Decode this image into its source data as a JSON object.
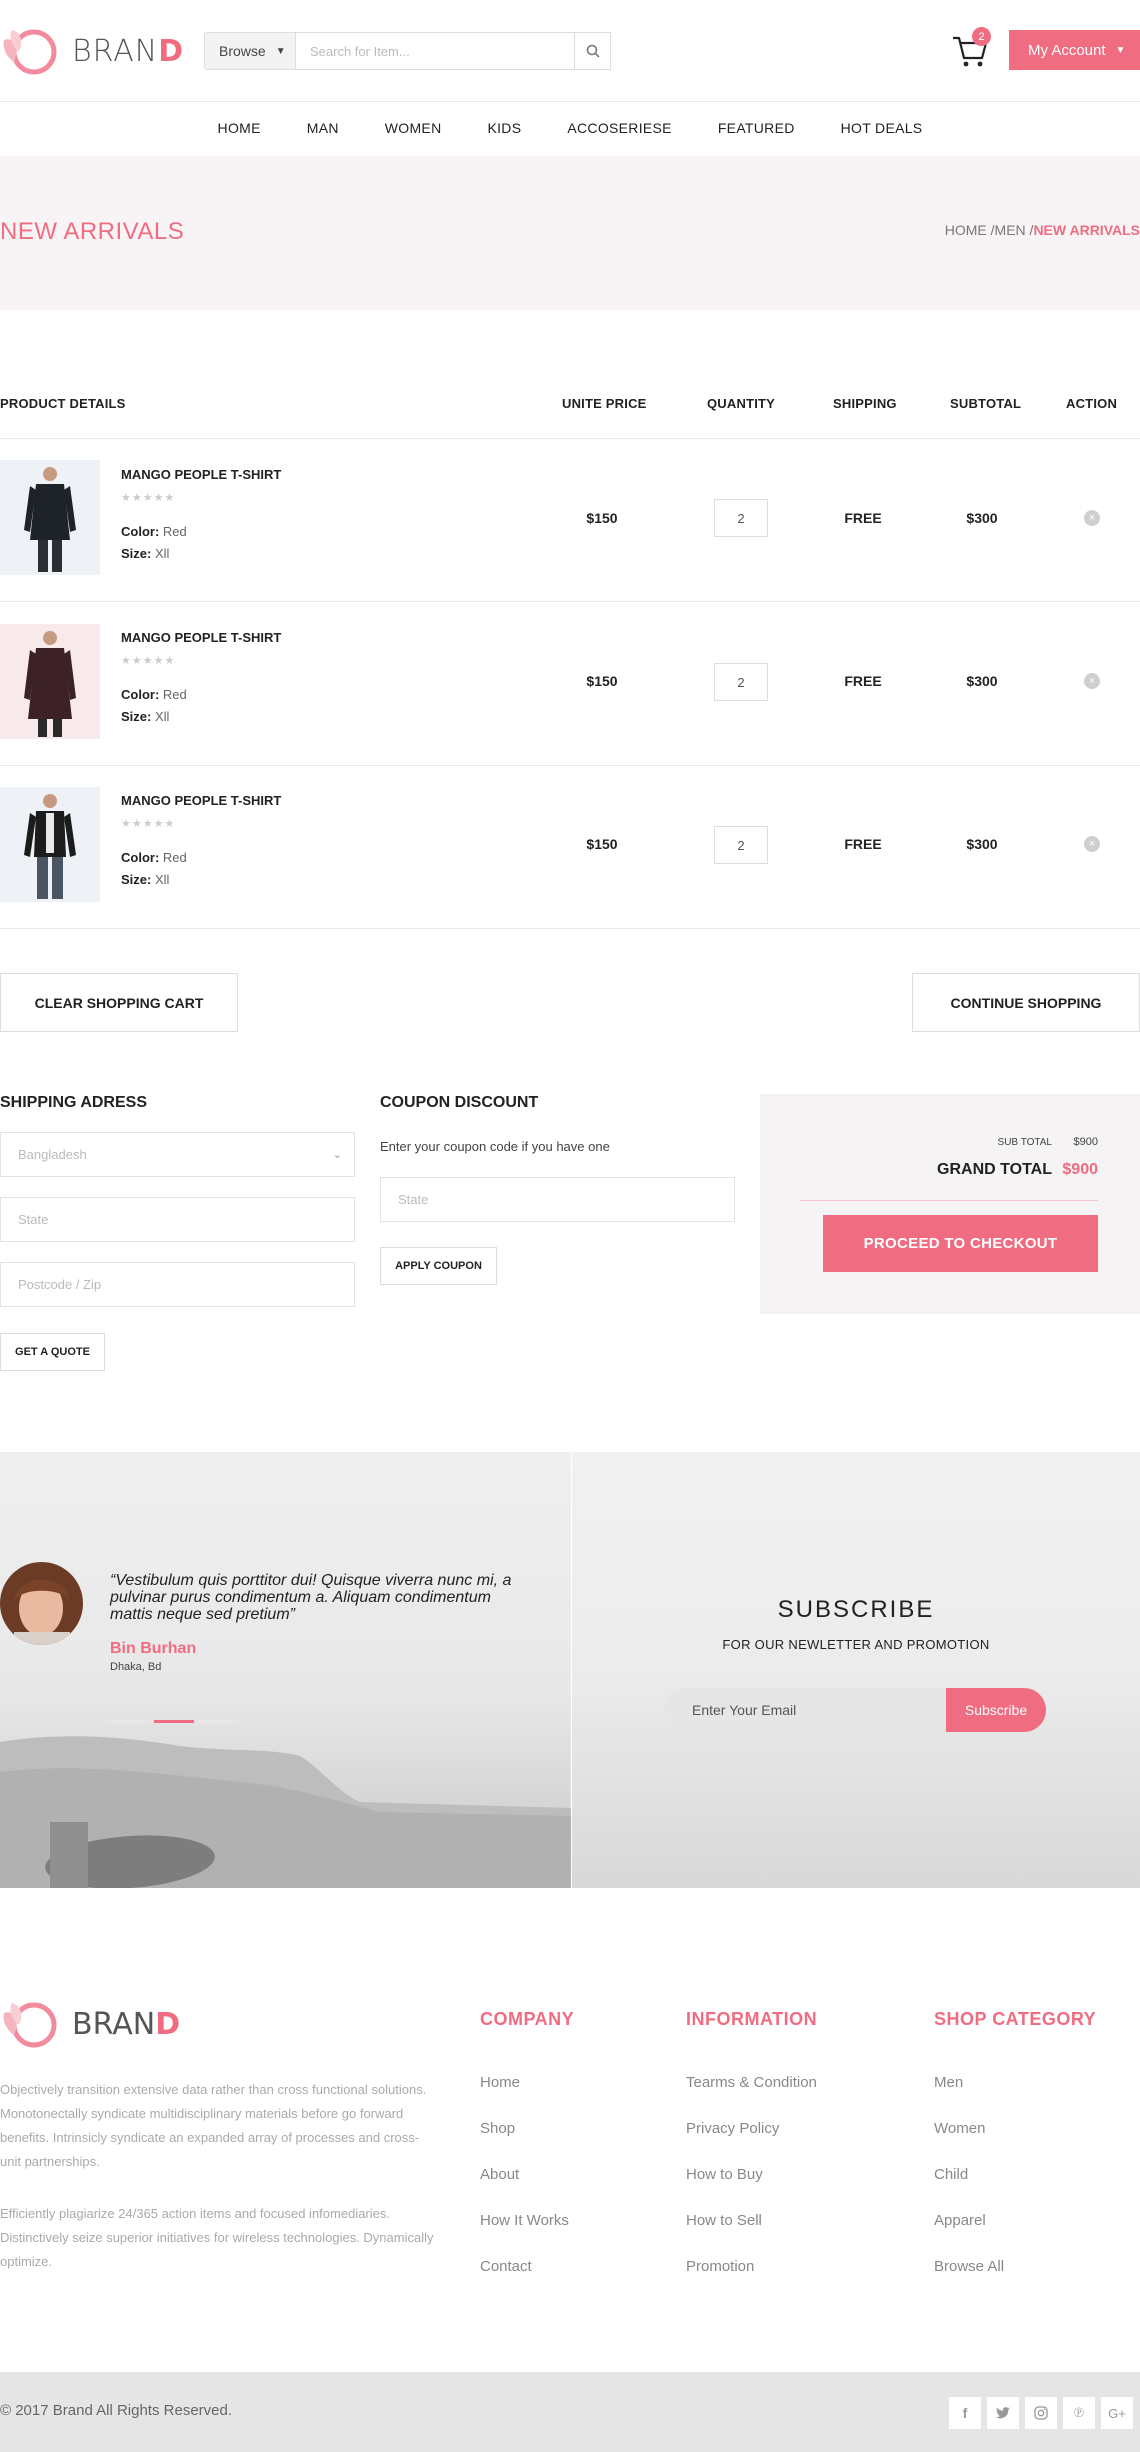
{
  "brand": {
    "name_main": "BRAN",
    "name_accent": "D"
  },
  "header": {
    "browse_label": "Browse",
    "search_placeholder": "Search for Item...",
    "cart_count": "2",
    "account_label": "My Account"
  },
  "nav": [
    "HOME",
    "MAN",
    "WOMEN",
    "KIDS",
    "ACCOSERIESE",
    "FEATURED",
    "HOT DEALS"
  ],
  "banner": {
    "title": "NEW ARRIVALS",
    "crumb_home": "HOME",
    "crumb_men": "MEN",
    "crumb_active": "NEW ARRIVALS"
  },
  "table": {
    "headers": [
      "PRODUCT DETAILS",
      "UNITE PRICE",
      "QUANTITY",
      "SHIPPING",
      "SUBTOTAL",
      "ACTION"
    ],
    "rows": [
      {
        "name": "MANGO PEOPLE T-SHIRT",
        "stars": "★★★★★",
        "color_label": "Color:",
        "color": "Red",
        "size_label": "Size:",
        "size": "Xll",
        "price": "$150",
        "qty": "2",
        "shipping": "FREE",
        "subtotal": "$300"
      },
      {
        "name": "MANGO PEOPLE T-SHIRT",
        "stars": "★★★★★",
        "color_label": "Color:",
        "color": "Red",
        "size_label": "Size:",
        "size": "Xll",
        "price": "$150",
        "qty": "2",
        "shipping": "FREE",
        "subtotal": "$300"
      },
      {
        "name": "MANGO PEOPLE T-SHIRT",
        "stars": "★★★★★",
        "color_label": "Color:",
        "color": "Red",
        "size_label": "Size:",
        "size": "Xll",
        "price": "$150",
        "qty": "2",
        "shipping": "FREE",
        "subtotal": "$300"
      }
    ],
    "clear_label": "CLEAR SHOPPING CART",
    "continue_label": "CONTINUE SHOPPING"
  },
  "shipping": {
    "title": "SHIPPING ADRESS",
    "country": "Bangladesh",
    "state_placeholder": "State",
    "zip_placeholder": "Postcode / Zip",
    "quote_label": "GET A QUOTE"
  },
  "coupon": {
    "title": "COUPON DISCOUNT",
    "hint": "Enter your coupon code if you have one",
    "placeholder": "State",
    "apply_label": "APPLY COUPON"
  },
  "summary": {
    "sub_label": "SUB TOTAL",
    "sub_value": "$900",
    "grand_label": "GRAND TOTAL",
    "grand_value": "$900",
    "checkout_label": "PROCEED TO CHECKOUT"
  },
  "testimonial": {
    "quote": "“Vestibulum quis porttitor dui! Quisque viverra nunc mi, a pulvinar purus condimentum a. Aliquam condimentum mattis neque sed pretium”",
    "name": "Bin Burhan",
    "location": "Dhaka, Bd"
  },
  "subscribe": {
    "title": "SUBSCRIBE",
    "subtitle": "FOR OUR NEWLETTER AND PROMOTION",
    "email_placeholder": "Enter Your Email",
    "button_label": "Subscribe"
  },
  "footer": {
    "para1": "Objectively transition extensive data rather than cross functional solutions. Monotonectally syndicate multidisciplinary materials before go forward benefits. Intrinsicly syndicate an expanded array of processes and cross-unit partnerships.",
    "para2": "Efficiently plagiarize 24/365 action items and focused infomediaries. Distinctively seize superior initiatives for wireless technologies. Dynamically optimize.",
    "company_title": "COMPANY",
    "company": [
      "Home",
      "Shop",
      "About",
      "How It Works",
      "Contact"
    ],
    "info_title": "INFORMATION",
    "info": [
      "Tearms & Condition",
      "Privacy Policy",
      "How to Buy",
      "How to Sell",
      "Promotion"
    ],
    "shop_title": "SHOP CATEGORY",
    "shop": [
      "Men",
      "Women",
      "Child",
      "Apparel",
      "Browse All"
    ],
    "copyright": "© 2017 Brand All Rights Reserved.",
    "social_icons": [
      "facebook-icon",
      "twitter-icon",
      "instagram-icon",
      "pinterest-icon",
      "google-plus-icon"
    ]
  },
  "colors": {
    "accent": "#f06c80",
    "banner_bg": "#f8f4f5"
  }
}
